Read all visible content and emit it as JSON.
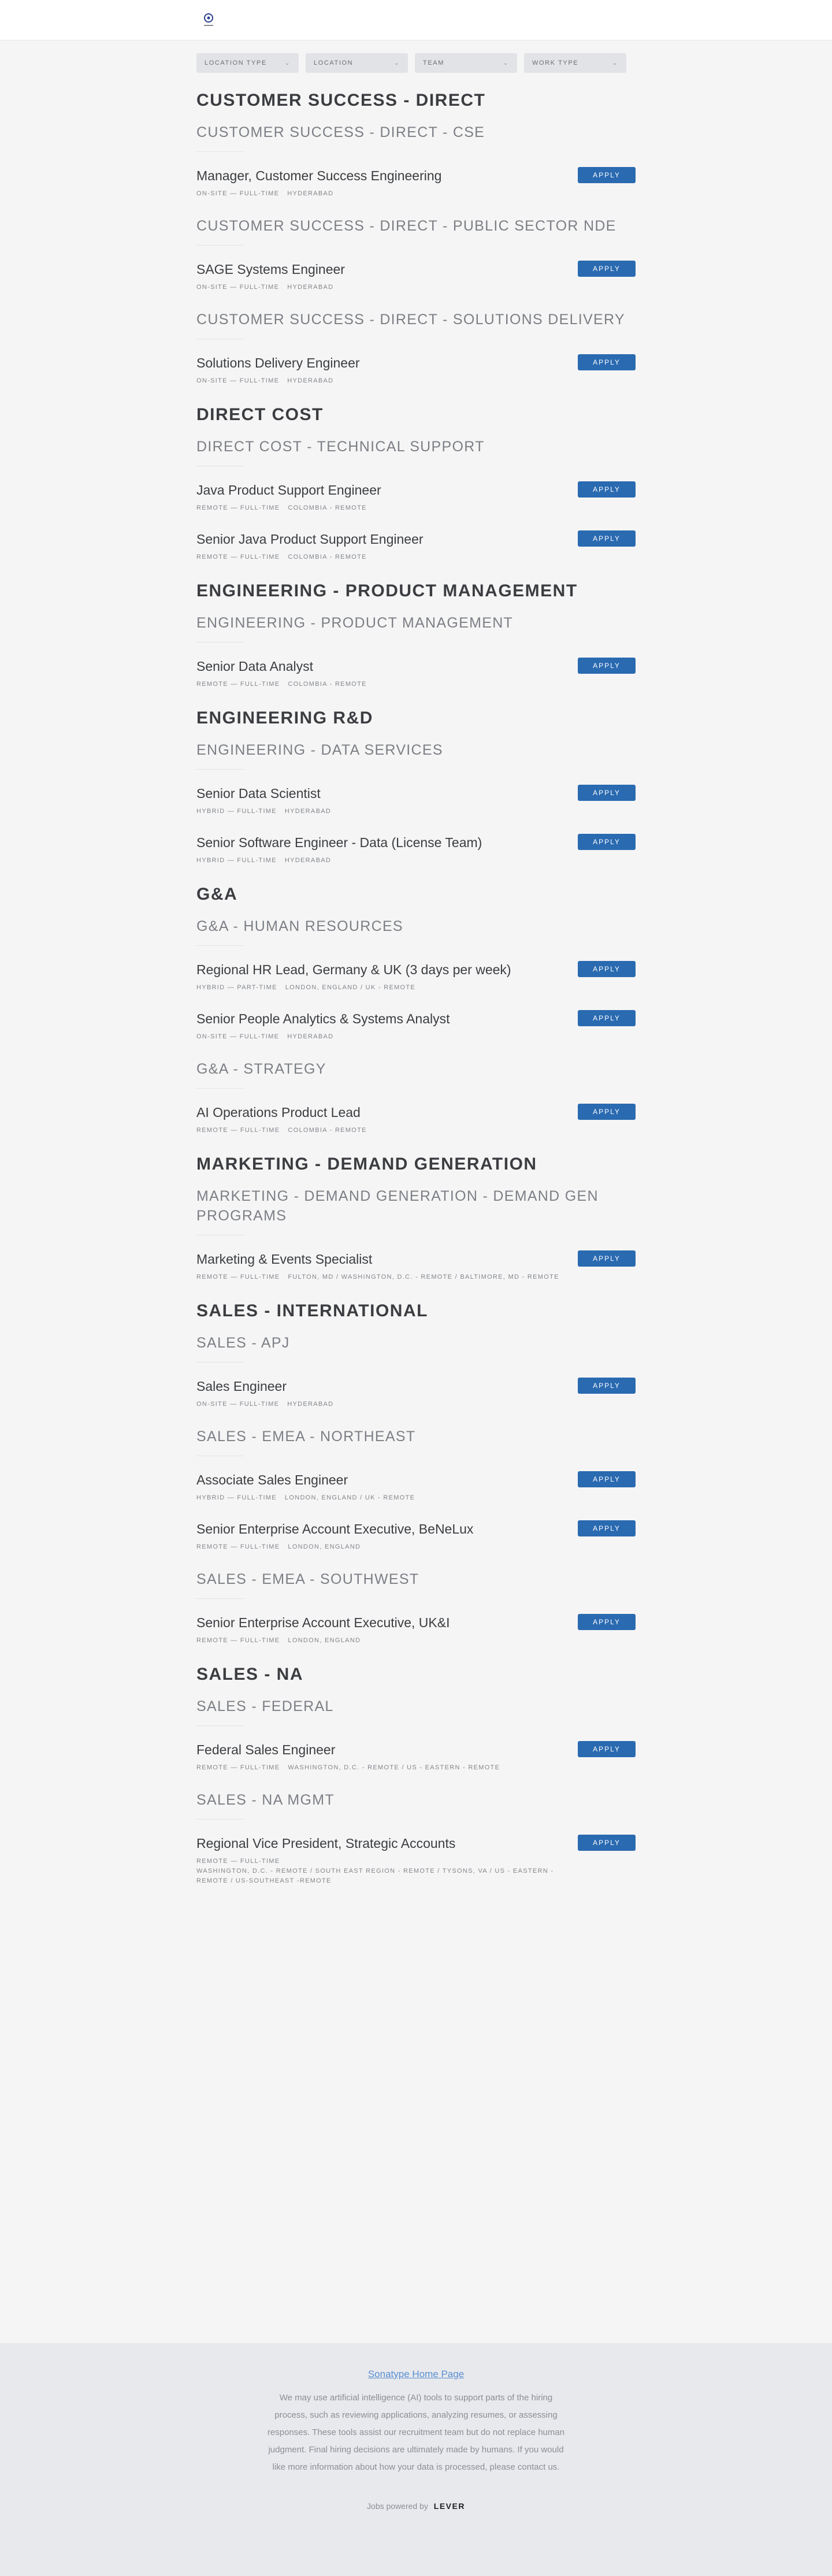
{
  "filters": [
    {
      "label": "LOCATION TYPE"
    },
    {
      "label": "LOCATION"
    },
    {
      "label": "TEAM"
    },
    {
      "label": "WORK TYPE"
    }
  ],
  "apply_label": "APPLY",
  "departments": [
    {
      "name": "CUSTOMER SUCCESS - DIRECT",
      "teams": [
        {
          "name": "CUSTOMER SUCCESS - DIRECT - CSE",
          "postings": [
            {
              "title": "Manager, Customer Success Engineering",
              "commitment": "ON-SITE — FULL-TIME",
              "location": "HYDERABAD"
            }
          ]
        },
        {
          "name": "CUSTOMER SUCCESS - DIRECT - PUBLIC SECTOR NDE",
          "postings": [
            {
              "title": "SAGE Systems Engineer",
              "commitment": "ON-SITE — FULL-TIME",
              "location": "HYDERABAD"
            }
          ]
        },
        {
          "name": "CUSTOMER SUCCESS - DIRECT - SOLUTIONS DELIVERY",
          "postings": [
            {
              "title": "Solutions Delivery Engineer",
              "commitment": "ON-SITE — FULL-TIME",
              "location": "HYDERABAD"
            }
          ]
        }
      ]
    },
    {
      "name": "DIRECT COST",
      "teams": [
        {
          "name": "DIRECT COST - TECHNICAL SUPPORT",
          "postings": [
            {
              "title": "Java Product Support Engineer",
              "commitment": "REMOTE — FULL-TIME",
              "location": "COLOMBIA - REMOTE"
            },
            {
              "title": "Senior Java Product Support Engineer",
              "commitment": "REMOTE — FULL-TIME",
              "location": "COLOMBIA - REMOTE"
            }
          ]
        }
      ]
    },
    {
      "name": "ENGINEERING - PRODUCT MANAGEMENT",
      "teams": [
        {
          "name": "ENGINEERING - PRODUCT MANAGEMENT",
          "postings": [
            {
              "title": "Senior Data Analyst",
              "commitment": "REMOTE — FULL-TIME",
              "location": "COLOMBIA - REMOTE"
            }
          ]
        }
      ]
    },
    {
      "name": "ENGINEERING R&D",
      "teams": [
        {
          "name": "ENGINEERING - DATA SERVICES",
          "postings": [
            {
              "title": "Senior Data Scientist",
              "commitment": "HYBRID — FULL-TIME",
              "location": "HYDERABAD"
            },
            {
              "title": "Senior Software Engineer - Data (License Team)",
              "commitment": "HYBRID — FULL-TIME",
              "location": "HYDERABAD"
            }
          ]
        }
      ]
    },
    {
      "name": "G&A",
      "teams": [
        {
          "name": "G&A - HUMAN RESOURCES",
          "postings": [
            {
              "title": "Regional HR Lead, Germany & UK (3 days per week)",
              "commitment": "HYBRID — PART-TIME",
              "location": "LONDON, ENGLAND / UK - REMOTE"
            },
            {
              "title": "Senior People Analytics & Systems Analyst",
              "commitment": "ON-SITE — FULL-TIME",
              "location": "HYDERABAD"
            }
          ]
        },
        {
          "name": "G&A - STRATEGY",
          "postings": [
            {
              "title": "AI Operations Product Lead",
              "commitment": "REMOTE — FULL-TIME",
              "location": "COLOMBIA - REMOTE"
            }
          ]
        }
      ]
    },
    {
      "name": "MARKETING - DEMAND GENERATION",
      "teams": [
        {
          "name": "MARKETING - DEMAND GENERATION - DEMAND GEN PROGRAMS",
          "postings": [
            {
              "title": "Marketing & Events Specialist",
              "commitment": "REMOTE — FULL-TIME",
              "location": "FULTON, MD / WASHINGTON, D.C. - REMOTE / BALTIMORE, MD - REMOTE"
            }
          ]
        }
      ]
    },
    {
      "name": "SALES - INTERNATIONAL",
      "teams": [
        {
          "name": "SALES - APJ",
          "postings": [
            {
              "title": "Sales Engineer",
              "commitment": "ON-SITE — FULL-TIME",
              "location": "HYDERABAD"
            }
          ]
        },
        {
          "name": "SALES - EMEA - NORTHEAST",
          "postings": [
            {
              "title": "Associate Sales Engineer",
              "commitment": "HYBRID — FULL-TIME",
              "location": "LONDON, ENGLAND / UK - REMOTE"
            },
            {
              "title": "Senior Enterprise Account Executive, BeNeLux",
              "commitment": "REMOTE — FULL-TIME",
              "location": "LONDON, ENGLAND"
            }
          ]
        },
        {
          "name": "SALES - EMEA - SOUTHWEST",
          "postings": [
            {
              "title": "Senior Enterprise Account Executive, UK&I",
              "commitment": "REMOTE — FULL-TIME",
              "location": "LONDON, ENGLAND"
            }
          ]
        }
      ]
    },
    {
      "name": "SALES - NA",
      "teams": [
        {
          "name": "SALES - FEDERAL",
          "postings": [
            {
              "title": "Federal Sales Engineer",
              "commitment": "REMOTE — FULL-TIME",
              "location": "WASHINGTON, D.C. - REMOTE / US - EASTERN - REMOTE"
            }
          ]
        },
        {
          "name": "SALES - NA MGMT",
          "postings": [
            {
              "title": "Regional Vice President, Strategic Accounts",
              "commitment": "REMOTE — FULL-TIME",
              "location": "WASHINGTON, D.C. - REMOTE / SOUTH EAST REGION - REMOTE / TYSONS, VA / US - EASTERN - REMOTE / US-SOUTHEAST -REMOTE",
              "location_wraps": true
            }
          ]
        }
      ]
    }
  ],
  "footer": {
    "home_link": "Sonatype Home Page",
    "disclaimer": "We may use artificial intelligence (AI) tools to support parts of the hiring process, such as reviewing applications, analyzing resumes, or assessing responses. These tools assist our recruitment team but do not replace human judgment. Final hiring decisions are ultimately made by humans. If you would like more information about how your data is processed, please contact us.",
    "powered_by": "Jobs powered by",
    "powered_brand": "LEVER"
  }
}
